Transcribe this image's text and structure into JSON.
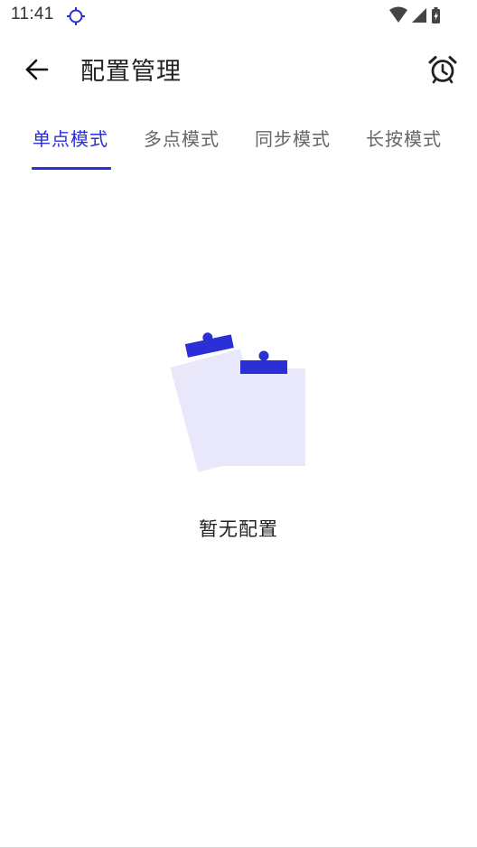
{
  "status_bar": {
    "time": "11:41",
    "location_icon": "location-crosshair-icon",
    "wifi_icon": "wifi-icon",
    "signal_icon": "cell-signal-icon",
    "battery_icon": "battery-charging-icon"
  },
  "app_bar": {
    "back_icon": "arrow-back-icon",
    "title": "配置管理",
    "alarm_icon": "alarm-clock-icon"
  },
  "tabs": [
    {
      "label": "单点模式",
      "active": true
    },
    {
      "label": "多点模式",
      "active": false
    },
    {
      "label": "同步模式",
      "active": false
    },
    {
      "label": "长按模式",
      "active": false
    }
  ],
  "empty_state": {
    "illustration_icon": "clipboard-empty-icon",
    "text": "暂无配置"
  },
  "colors": {
    "accent": "#2b2fd6",
    "illustration_light": "#e9e8fb",
    "tab_inactive": "#666666",
    "text_primary": "#222222"
  }
}
